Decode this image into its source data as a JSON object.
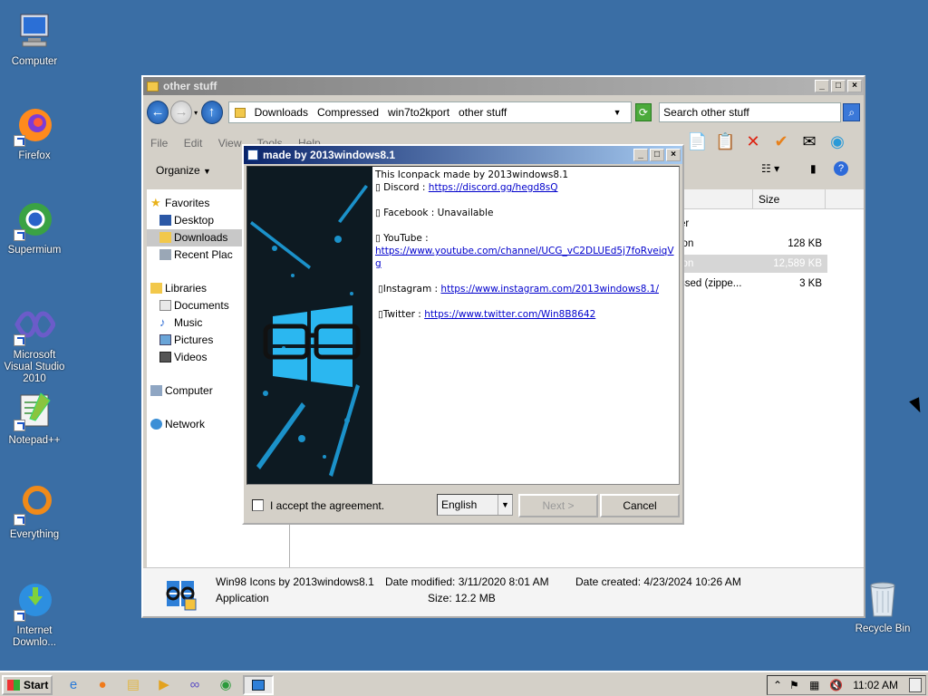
{
  "desktop": {
    "icons": [
      {
        "label": "Computer",
        "icon": "computer-icon"
      },
      {
        "label": "Firefox",
        "icon": "firefox-icon"
      },
      {
        "label": "Supermium",
        "icon": "supermium-icon"
      },
      {
        "label": "Microsoft Visual Studio 2010",
        "icon": "visual-studio-icon"
      },
      {
        "label": "Notepad++",
        "icon": "notepadpp-icon"
      },
      {
        "label": "Everything",
        "icon": "everything-icon"
      },
      {
        "label": "Internet Downlo...",
        "icon": "idm-icon"
      },
      {
        "label": "Recycle Bin",
        "icon": "recycle-bin-icon"
      }
    ]
  },
  "explorer": {
    "title": "other stuff",
    "breadcrumbs": [
      "Downloads",
      "Compressed",
      "win7to2kport",
      "other stuff"
    ],
    "search_placeholder": "Search other stuff",
    "menu": [
      "File",
      "Edit",
      "View",
      "Tools",
      "Help"
    ],
    "organize_label": "Organize",
    "nav": {
      "favorites": "Favorites",
      "desktop": "Desktop",
      "downloads": "Downloads",
      "recent": "Recent Plac",
      "libraries": "Libraries",
      "documents": "Documents",
      "music": "Music",
      "pictures": "Pictures",
      "videos": "Videos",
      "computer": "Computer",
      "network": "Network"
    },
    "columns": {
      "size": "Size"
    },
    "rows": [
      {
        "name": "er",
        "size": ""
      },
      {
        "name": "ion",
        "size": "128 KB"
      },
      {
        "name": "ion",
        "size": "12,589 KB"
      },
      {
        "name": "ssed (zippe...",
        "size": "3 KB"
      }
    ],
    "details": {
      "name": "Win98 Icons by 2013windows8.1",
      "type": "Application",
      "modified_label": "Date modified:",
      "modified": "3/11/2020 8:01 AM",
      "created_label": "Date created:",
      "created": "4/23/2024 10:26 AM",
      "size_label": "Size:",
      "size": "12.2 MB"
    }
  },
  "dialog": {
    "title": "made by 2013windows8.1",
    "line1": "This Iconpack made by 2013windows8.1",
    "discord_label": "▯ Discord : ",
    "discord_url": "https://discord.gg/hegd8sQ",
    "facebook": "▯ Facebook : Unavailable",
    "youtube_label": "▯ YouTube :",
    "youtube_url": "https://www.youtube.com/channel/UCG_vC2DLUEd5j7foRveiqVg",
    "instagram_label": "▯Instagram : ",
    "instagram_url": "https://www.instagram.com/2013windows8.1/",
    "twitter_label": "▯Twitter : ",
    "twitter_url": "https://www.twitter.com/Win8B8642",
    "accept_label": "I accept the agreement.",
    "language": "English",
    "next_label": "Next >",
    "cancel_label": "Cancel"
  },
  "taskbar": {
    "start_label": "Start",
    "clock": "11:02 AM"
  },
  "colors": {
    "desktop": "#3a6ea5",
    "dialog_title": "#0a246a",
    "link": "#0000cc"
  }
}
